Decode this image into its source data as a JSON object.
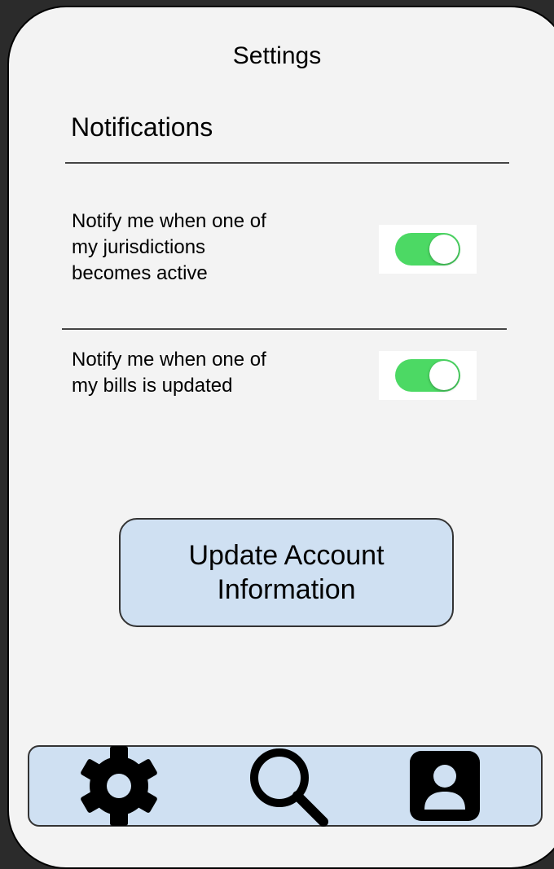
{
  "header": {
    "title": "Settings"
  },
  "notifications": {
    "section_title": "Notifications",
    "settings": [
      {
        "label": "Notify me when one of\nmy jurisdictions\nbecomes active",
        "enabled": true
      },
      {
        "label": "Notify me when one of\nmy bills is updated",
        "enabled": true
      }
    ]
  },
  "actions": {
    "update_account_label": "Update Account\nInformation"
  },
  "bottom_nav": {
    "items": [
      {
        "icon": "gear-icon"
      },
      {
        "icon": "search-icon"
      },
      {
        "icon": "profile-icon"
      }
    ]
  },
  "colors": {
    "toggle_on": "#4cd964",
    "button_fill": "#cfe0f2",
    "screen_background": "#f3f3f3"
  }
}
